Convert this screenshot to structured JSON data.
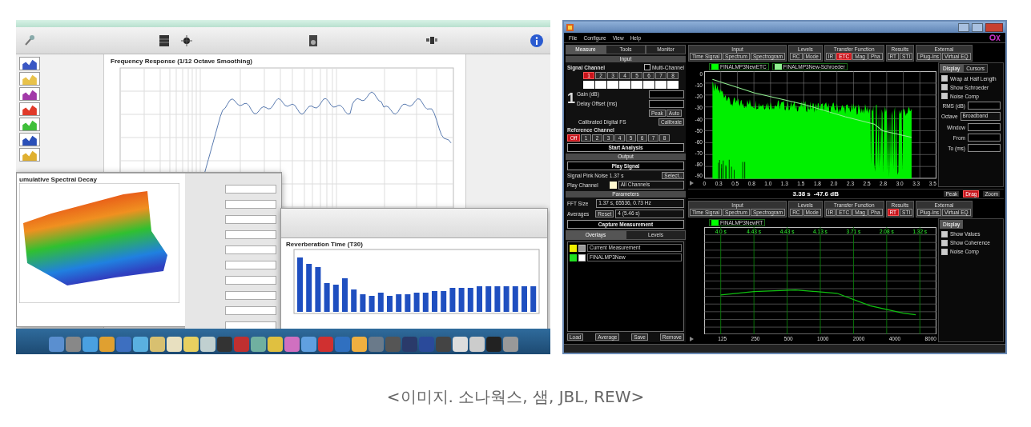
{
  "left_screenshot": {
    "measurement_thumbnails": [
      {
        "color": "#3a57c4"
      },
      {
        "color": "#e8c24a"
      },
      {
        "color": "#a23aa8"
      },
      {
        "color": "#e03a2a"
      },
      {
        "color": "#3fbf3a"
      },
      {
        "color": "#2a4fb8"
      },
      {
        "color": "#e0b030"
      }
    ],
    "response_chart": {
      "title": "Frequency Response (1/12 Octave Smoothing)"
    },
    "decay_window": {
      "title": "umulative Spectral Decay"
    },
    "rt_window": {
      "title": "Reverberation Time (T30)"
    }
  },
  "right_screenshot": {
    "menu": [
      "File",
      "Configure",
      "View",
      "Help"
    ],
    "side_tabs": [
      {
        "label": "Measure",
        "selected": true
      },
      {
        "label": "Tools",
        "selected": false
      },
      {
        "label": "Monitor",
        "selected": false
      }
    ],
    "input_title": "Input",
    "signal_channel_label": "Signal Channel",
    "multi_channel": {
      "label": "Multi-Channel",
      "checked": false
    },
    "channels": [
      {
        "label": "1",
        "selected": true
      },
      {
        "label": "2",
        "selected": false
      },
      {
        "label": "3",
        "selected": false
      },
      {
        "label": "4",
        "selected": false
      },
      {
        "label": "5",
        "selected": false
      },
      {
        "label": "6",
        "selected": false
      },
      {
        "label": "7",
        "selected": false
      },
      {
        "label": "8",
        "selected": false
      }
    ],
    "channel_number": "1",
    "gain_label": "Gain (dB)",
    "delay_label": "Delay Offset (ms)",
    "peak_button": "Peak",
    "auto_button": "Auto",
    "calibrated_label": "Calibrated Digital FS",
    "calibrate_button": "Calibrate",
    "reference_label": "Reference Channel",
    "reference_channels": [
      {
        "label": "Off",
        "selected": true
      },
      {
        "label": "1",
        "selected": false
      },
      {
        "label": "2",
        "selected": false
      },
      {
        "label": "3",
        "selected": false
      },
      {
        "label": "4",
        "selected": false
      },
      {
        "label": "5",
        "selected": false
      },
      {
        "label": "6",
        "selected": false
      },
      {
        "label": "7",
        "selected": false
      },
      {
        "label": "8",
        "selected": false
      }
    ],
    "start_button": "Start Analysis",
    "output_title": "Output",
    "play_button": "Play Signal",
    "signal_info": "Signal Pink Noise 1.37 s",
    "select_button": "Select..",
    "play_channel_label": "Play Channel",
    "play_channel_value": "All Channels",
    "parameters_title": "Parameters",
    "fft_label": "FFT Size",
    "fft_value": "1.37 s, 65536, 0.73 Hz",
    "averages_label": "Averages",
    "reset_button": "Reset",
    "averages_value": "4 (5.46 s)",
    "capture_button": "Capture Measurement",
    "overlay_tabs": [
      {
        "label": "Overlays",
        "selected": true
      },
      {
        "label": "Levels",
        "selected": false
      }
    ],
    "overlays": [
      {
        "name": "Current Measurement",
        "color": "#f0f000",
        "checked": true
      },
      {
        "name": "FINALMP3New",
        "color": "#20e020",
        "checked": false
      }
    ],
    "overlay_buttons": [
      "Load",
      "Average",
      "Save",
      "Remove"
    ],
    "views": [
      {
        "kind": "etc",
        "groups": [
          {
            "title": "Input",
            "buttons": [
              {
                "label": "Time Signal",
                "selected": false
              },
              {
                "label": "Spectrum",
                "selected": false
              },
              {
                "label": "Spectrogram",
                "selected": false
              }
            ]
          },
          {
            "title": "Levels",
            "buttons": [
              {
                "label": "RC",
                "selected": false
              },
              {
                "label": "Mode",
                "selected": false
              }
            ]
          },
          {
            "title": "Transfer Function",
            "buttons": [
              {
                "label": "IR",
                "selected": false
              },
              {
                "label": "ETC",
                "selected": true
              },
              {
                "label": "Mag",
                "selected": false
              },
              {
                "label": "Pha",
                "selected": false
              }
            ]
          },
          {
            "title": "Results",
            "buttons": [
              {
                "label": "RT",
                "selected": false
              },
              {
                "label": "STI",
                "selected": false
              }
            ]
          },
          {
            "title": "External",
            "buttons": [
              {
                "label": "Plug-Ins",
                "selected": false
              },
              {
                "label": "Virtual EQ",
                "selected": false
              }
            ]
          }
        ],
        "legend": [
          {
            "label": "FINALMP3NewETC",
            "color": "#00ff00"
          },
          {
            "label": "FINALMP3New-Schroeder",
            "color": "#90ee90"
          }
        ],
        "y_labels": [
          "0",
          "-10",
          "-20",
          "-30",
          "-40",
          "-50",
          "-60",
          "-70",
          "-80",
          "-90"
        ],
        "x_labels": [
          "0",
          "0.3",
          "0.5",
          "0.8",
          "1.0",
          "1.3",
          "1.5",
          "1.8",
          "2.0",
          "2.3",
          "2.5",
          "2.8",
          "3.0",
          "3.3",
          "3.5"
        ],
        "side_tabs": [
          {
            "label": "Display",
            "selected": true
          },
          {
            "label": "Cursors",
            "selected": false
          }
        ],
        "options": [
          {
            "kind": "checkbox",
            "label": "Wrap at Half Length",
            "checked": true
          },
          {
            "kind": "checkbox",
            "label": "Show Schroeder",
            "checked": true
          },
          {
            "kind": "checkbox",
            "label": "Noise Comp",
            "checked": true
          },
          {
            "kind": "field",
            "label": "RMS (dB)"
          },
          {
            "kind": "select",
            "label": "Octave",
            "value": "Broadband"
          },
          {
            "kind": "field",
            "label": "Window"
          },
          {
            "kind": "field",
            "label": "From"
          },
          {
            "kind": "field",
            "label": "To (ms)"
          }
        ]
      },
      {
        "kind": "rt",
        "groups": [
          {
            "title": "Input",
            "buttons": [
              {
                "label": "Time Signal",
                "selected": false
              },
              {
                "label": "Spectrum",
                "selected": false
              },
              {
                "label": "Spectrogram",
                "selected": false
              }
            ]
          },
          {
            "title": "Levels",
            "buttons": [
              {
                "label": "RC",
                "selected": false
              },
              {
                "label": "Mode",
                "selected": false
              }
            ]
          },
          {
            "title": "Transfer Function",
            "buttons": [
              {
                "label": "IR",
                "selected": false
              },
              {
                "label": "ETC",
                "selected": false
              },
              {
                "label": "Mag",
                "selected": false
              },
              {
                "label": "Pha",
                "selected": false
              }
            ]
          },
          {
            "title": "Results",
            "buttons": [
              {
                "label": "RT",
                "selected": true
              },
              {
                "label": "STI",
                "selected": false
              }
            ]
          },
          {
            "title": "External",
            "buttons": [
              {
                "label": "Plug-Ins",
                "selected": false
              },
              {
                "label": "Virtual EQ",
                "selected": false
              }
            ]
          }
        ],
        "legend": [
          {
            "label": "FINALMP3NewRT",
            "color": "#00ff00"
          }
        ],
        "value_labels": [
          "4.0 s",
          "4.43 s",
          "4.43 s",
          "4.13 s",
          "3.71 s",
          "2.08 s",
          "1.32 s"
        ],
        "x_labels": [
          "125",
          "250",
          "500",
          "1000",
          "2000",
          "4000",
          "8000"
        ],
        "side_tabs": [
          {
            "label": "Display",
            "selected": true
          }
        ],
        "options": [
          {
            "kind": "checkbox",
            "label": "Show Values",
            "checked": true
          },
          {
            "kind": "checkbox",
            "label": "Show Coherence",
            "checked": true
          },
          {
            "kind": "checkbox",
            "label": "Noise Comp",
            "checked": true
          }
        ]
      }
    ],
    "readout": {
      "time": "3.38 s",
      "level": "-47.6 dB",
      "tools": [
        {
          "label": "Peak",
          "selected": false
        },
        {
          "label": "Drag",
          "selected": true
        },
        {
          "label": "Zoom",
          "selected": false
        }
      ]
    }
  },
  "caption": "<이미지. 소나웍스, 샘, JBL, REW>"
}
